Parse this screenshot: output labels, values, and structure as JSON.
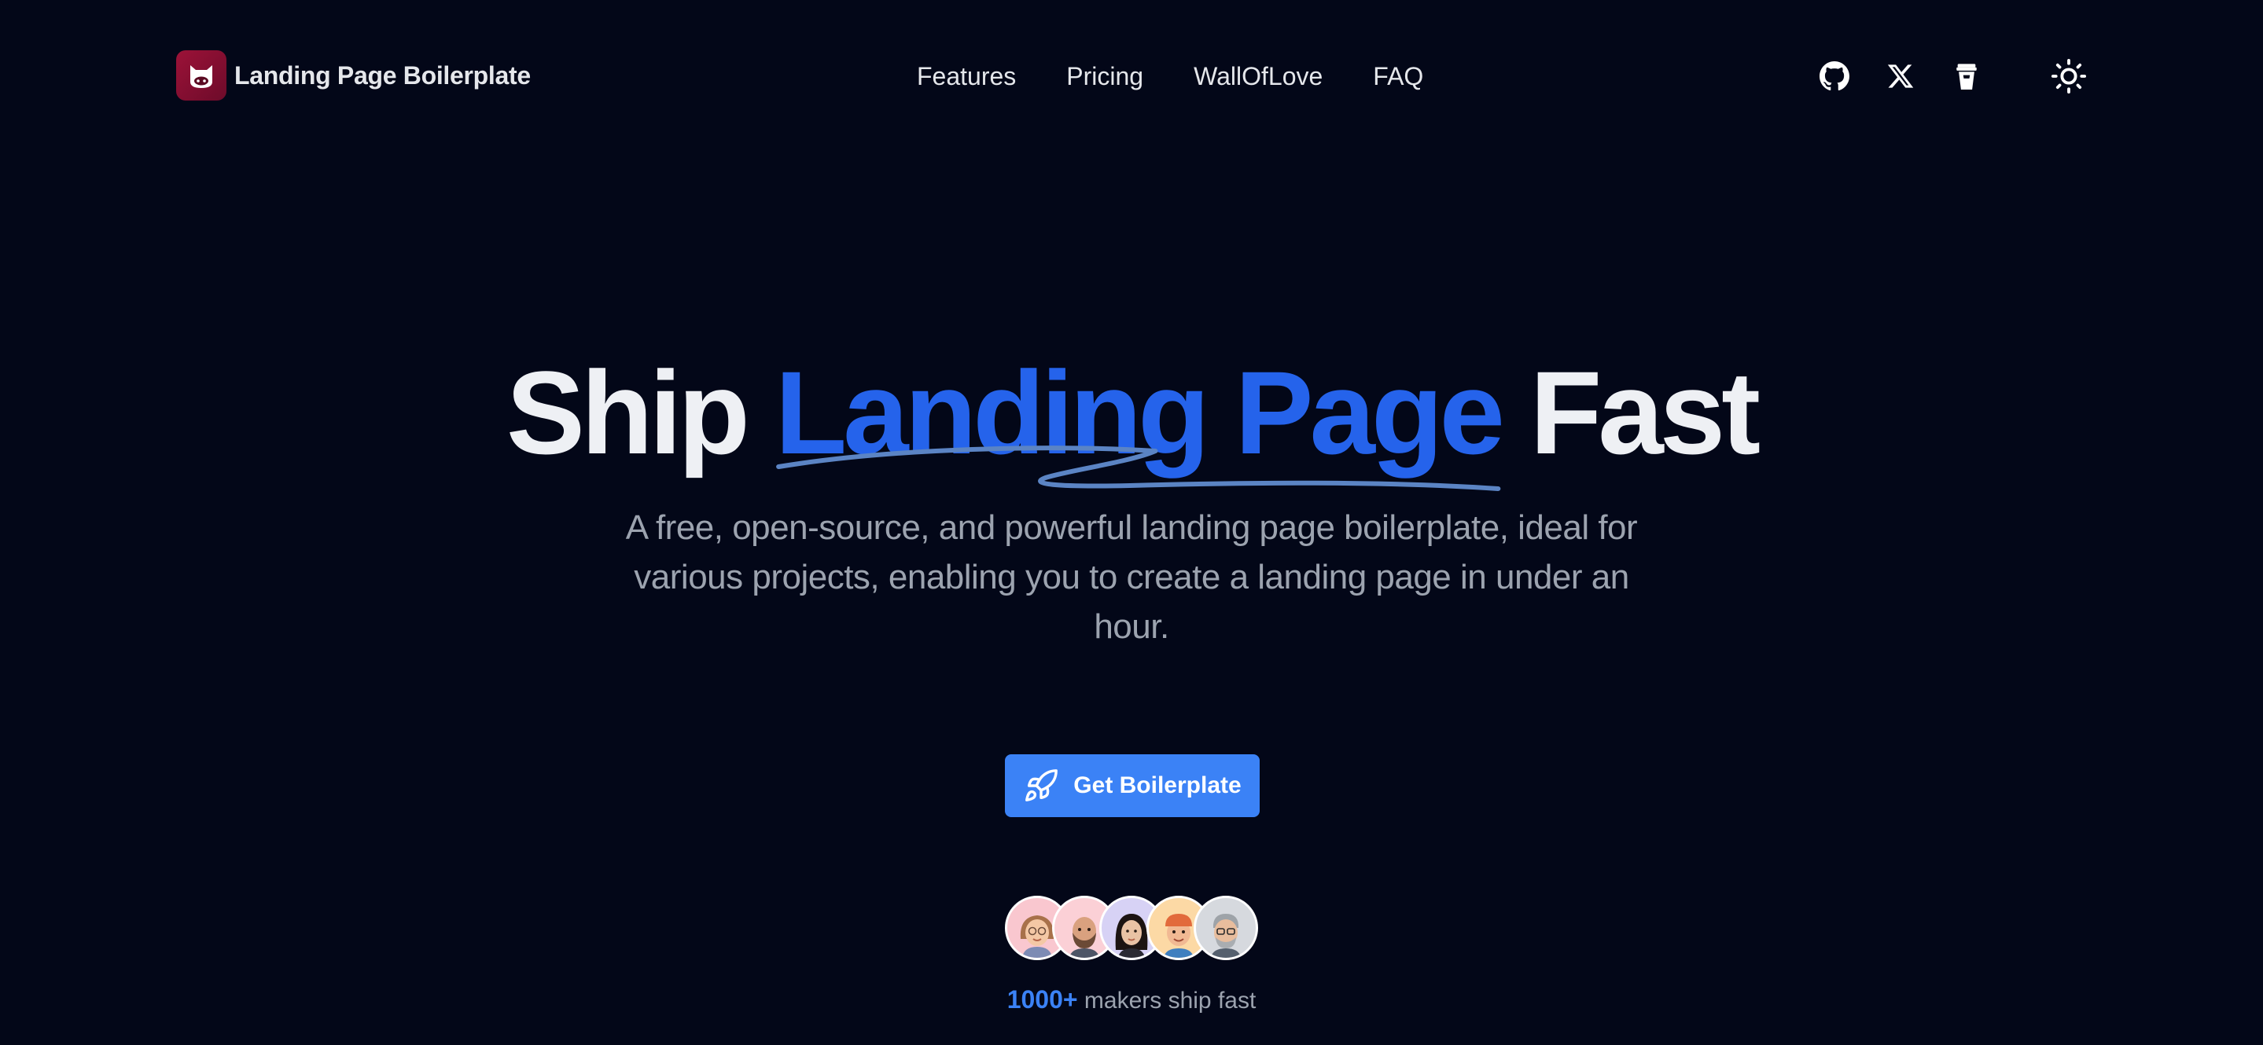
{
  "header": {
    "brand_name": "Landing Page Boilerplate",
    "nav": [
      {
        "label": "Features"
      },
      {
        "label": "Pricing"
      },
      {
        "label": "WallOfLove"
      },
      {
        "label": "FAQ"
      }
    ],
    "icons": [
      "github-icon",
      "x-twitter-icon",
      "coffee-cup-icon",
      "sun-icon"
    ]
  },
  "hero": {
    "title_start": "Ship ",
    "title_accent": "Landing Page",
    "title_end": " Fast",
    "subtitle": "A free, open-source, and powerful landing page boilerplate, ideal for various projects, enabling you to create a landing page in under an hour.",
    "cta_label": "Get Boilerplate",
    "cta_icon": "rocket-icon"
  },
  "social_proof": {
    "count": "1000+",
    "text": " makers ship fast",
    "avatars": [
      "avatar-1",
      "avatar-2",
      "avatar-3",
      "avatar-4",
      "avatar-5"
    ]
  },
  "colors": {
    "background": "#030718",
    "accent": "#2563eb",
    "button": "#3b82f6",
    "brand_logo": "#8b0f33"
  }
}
